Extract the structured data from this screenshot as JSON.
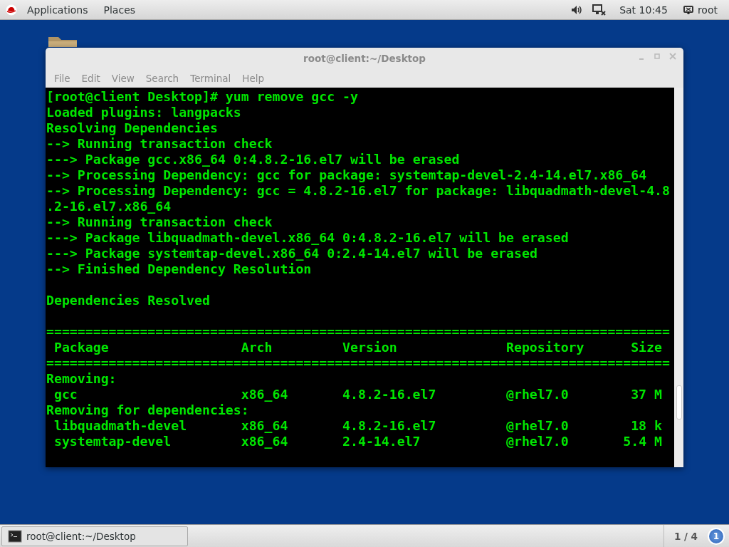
{
  "top_bar": {
    "menus": [
      "Applications",
      "Places"
    ],
    "clock": "Sat 10:45",
    "user": "root"
  },
  "window": {
    "title": "root@client:~/Desktop",
    "menu": [
      "File",
      "Edit",
      "View",
      "Search",
      "Terminal",
      "Help"
    ]
  },
  "terminal": {
    "lines": [
      {
        "kind": "text",
        "text": "[root@client Desktop]# yum remove gcc -y"
      },
      {
        "kind": "text",
        "text": "Loaded plugins: langpacks"
      },
      {
        "kind": "text",
        "text": "Resolving Dependencies"
      },
      {
        "kind": "text",
        "text": "--> Running transaction check"
      },
      {
        "kind": "text",
        "text": "---> Package gcc.x86_64 0:4.8.2-16.el7 will be erased"
      },
      {
        "kind": "text",
        "text": "--> Processing Dependency: gcc for package: systemtap-devel-2.4-14.el7.x86_64"
      },
      {
        "kind": "text",
        "text": "--> Processing Dependency: gcc = 4.8.2-16.el7 for package: libquadmath-devel-4.8"
      },
      {
        "kind": "text",
        "text": ".2-16.el7.x86_64"
      },
      {
        "kind": "text",
        "text": "--> Running transaction check"
      },
      {
        "kind": "text",
        "text": "---> Package libquadmath-devel.x86_64 0:4.8.2-16.el7 will be erased"
      },
      {
        "kind": "text",
        "text": "---> Package systemtap-devel.x86_64 0:2.4-14.el7 will be erased"
      },
      {
        "kind": "text",
        "text": "--> Finished Dependency Resolution"
      },
      {
        "kind": "blank"
      },
      {
        "kind": "text",
        "text": "Dependencies Resolved"
      },
      {
        "kind": "blank"
      },
      {
        "kind": "text",
        "text": "================================================================================"
      },
      {
        "kind": "row",
        "cells": [
          "Package",
          "Arch",
          "Version",
          "Repository",
          "Size"
        ]
      },
      {
        "kind": "text",
        "text": "================================================================================"
      },
      {
        "kind": "text",
        "text": "Removing:"
      },
      {
        "kind": "row",
        "cells": [
          "gcc",
          "x86_64",
          "4.8.2-16.el7",
          "@rhel7.0",
          "37 M"
        ]
      },
      {
        "kind": "text",
        "text": "Removing for dependencies:"
      },
      {
        "kind": "row",
        "cells": [
          "libquadmath-devel",
          "x86_64",
          "4.8.2-16.el7",
          "@rhel7.0",
          "18 k"
        ]
      },
      {
        "kind": "row",
        "cells": [
          "systemtap-devel",
          "x86_64",
          "2.4-14.el7",
          "@rhel7.0",
          "5.4 M"
        ]
      }
    ]
  },
  "taskbar": {
    "task": "root@client:~/Desktop",
    "workspace": "1 / 4",
    "notifications": "1"
  }
}
